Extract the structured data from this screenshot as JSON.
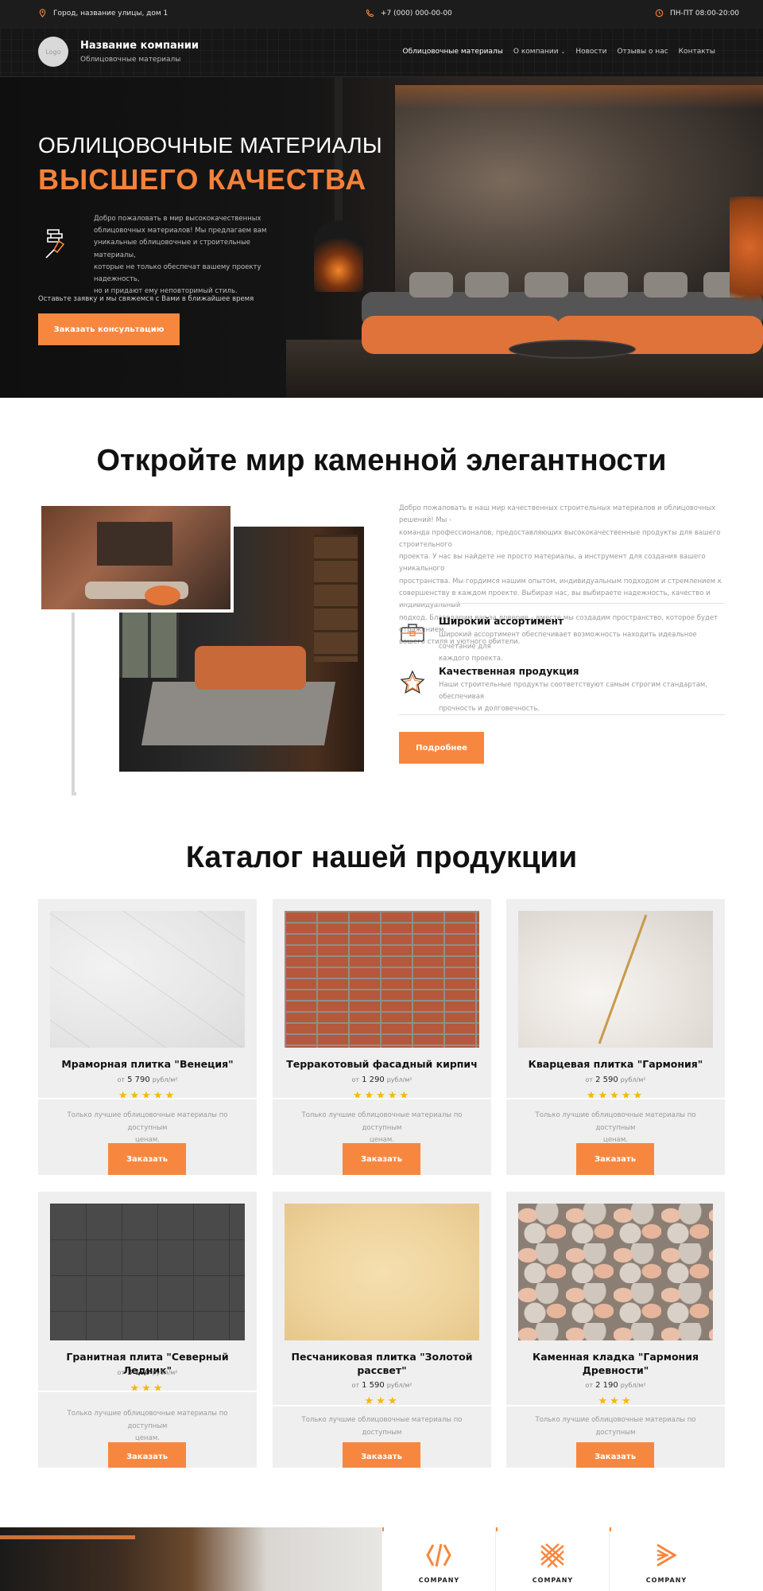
{
  "topbar": {
    "address": "Город, название улицы, дом 1",
    "phone": "+7 (000) 000-00-00",
    "hours": "ПН-ПТ 08:00-20:00"
  },
  "header": {
    "logo_text": "Logo",
    "company_name": "Название компании",
    "company_sub": "Облицовочные материалы",
    "nav": [
      "Облицовочные материалы",
      "О компании",
      "Новости",
      "Отзывы о нас",
      "Контакты"
    ]
  },
  "hero": {
    "title_line1": "ОБЛИЦОВОЧНЫЕ МАТЕРИАЛЫ",
    "title_line2": "ВЫСШЕГО КАЧЕСТВА",
    "description_lines": [
      "Добро пожаловать в мир высококачественных",
      "облицовочных материалов! Мы предлагаем вам",
      "уникальные облицовочные и строительные материалы,",
      "которые не только обеспечат вашему проекту надежность,",
      "но и придают ему неповторимый стиль."
    ],
    "note": "Оставьте заявку и мы свяжемся с Вами в ближайшее время",
    "button": "Заказать консультацию"
  },
  "about": {
    "title": "Откройте мир каменной элегантности",
    "text_lines": [
      "Добро пожаловать в наш мир качественных строительных материалов и облицовочных решений! Мы -",
      "команда профессионалов, предоставляющих высококачественные продукты для вашего строительного",
      "проекта. У нас вы найдете не просто материалы, а инструмент для создания вашего уникального",
      "пространства. Мы гордимся нашим опытом, индивидуальным подходом и стремлением к",
      "совершенству в каждом проекте. Выбирая нас, вы выбираете надежность, качество и индивидуальный",
      "подход. Благодарим вас за доверие – вместе мы создадим пространство, которое будет отражением",
      "вашего стиля и уютного обители."
    ],
    "features": [
      {
        "title": "Широкий ассортимент",
        "desc_lines": [
          "Широкий ассортимент обеспечивает возможность находить идеальное сочетание для",
          "каждого проекта."
        ],
        "icon": "toolbox-icon"
      },
      {
        "title": "Качественная продукция",
        "desc_lines": [
          "Наши строительные продукты соответствуют самым строгим стандартам, обеспечивая",
          "прочность и долговечность."
        ],
        "icon": "star-outline-icon"
      }
    ],
    "button": "Подробнее"
  },
  "catalog": {
    "title": "Каталог нашей продукции",
    "price_prefix": "от",
    "unit": "рубл/м²",
    "description_lines": [
      "Только лучшие облицовочные материалы по доступным",
      "ценам."
    ],
    "button": "Заказать",
    "products": [
      {
        "name": "Мраморная плитка \"Венеция\"",
        "price": "5 790",
        "stars": "★★★★★",
        "rating": 5,
        "texture": "marble"
      },
      {
        "name": "Терракотовый фасадный кирпич",
        "price": "1 290",
        "stars": "★★★★★",
        "rating": 5,
        "texture": "brick"
      },
      {
        "name": "Кварцевая плитка \"Гармония\"",
        "price": "2 590",
        "stars": "★★★★★",
        "rating": 5,
        "texture": "quartz"
      },
      {
        "name": "Гранитная плита \"Северный Ледник\"",
        "price": "3 190",
        "stars": "★★★",
        "rating": 3,
        "texture": "granite"
      },
      {
        "name_lines": [
          "Песчаниковая плитка \"Золотой",
          "рассвет\""
        ],
        "price": "1 590",
        "stars": "★★★",
        "rating": 3,
        "texture": "sandstone"
      },
      {
        "name_lines": [
          "Каменная кладка \"Гармония",
          "Древности\""
        ],
        "price": "2 190",
        "stars": "★★★",
        "rating": 3,
        "texture": "stone"
      }
    ]
  },
  "partners": [
    {
      "name": "COMPANY",
      "icon": "brackets-logo-icon"
    },
    {
      "name": "COMPANY",
      "icon": "lattice-logo-icon"
    },
    {
      "name": "COMPANY",
      "icon": "stripes-logo-icon"
    }
  ],
  "colors": {
    "accent": "#f7873f",
    "star": "#f5b800",
    "dark": "#1c1c1c"
  }
}
